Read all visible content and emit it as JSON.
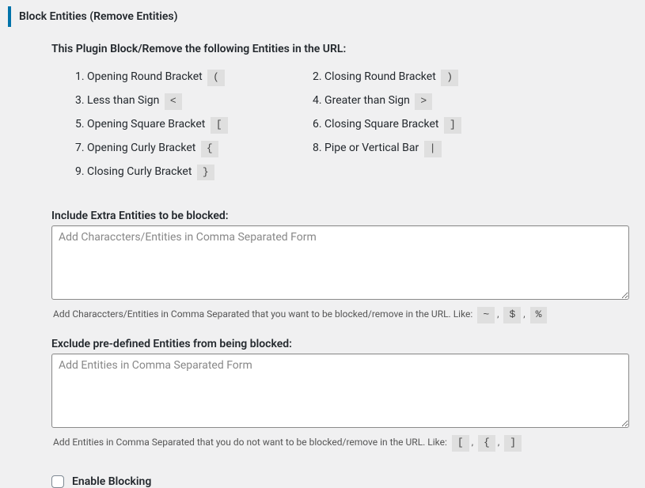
{
  "heading": "Block Entities (Remove Entities)",
  "intro": "This Plugin Block/Remove the following Entities in the URL:",
  "entities": [
    {
      "num": "1.",
      "label": "Opening Round Bracket",
      "char": "("
    },
    {
      "num": "2.",
      "label": "Closing Round Bracket",
      "char": ")"
    },
    {
      "num": "3.",
      "label": "Less than Sign",
      "char": "<"
    },
    {
      "num": "4.",
      "label": "Greater than Sign",
      "char": ">"
    },
    {
      "num": "5.",
      "label": "Opening Square Bracket",
      "char": "["
    },
    {
      "num": "6.",
      "label": "Closing Square Bracket",
      "char": "]"
    },
    {
      "num": "7.",
      "label": "Opening Curly Bracket",
      "char": "{"
    },
    {
      "num": "8.",
      "label": "Pipe or Vertical Bar",
      "char": "|"
    },
    {
      "num": "9.",
      "label": "Closing Curly Bracket",
      "char": "}"
    }
  ],
  "include": {
    "label": "Include Extra Entities to be blocked:",
    "placeholder": "Add Characcters/Entities in Comma Separated Form",
    "help_pre": "Add Characcters/Entities in Comma Separated that you want to be blocked/remove in the URL. Like:",
    "chips": [
      "~",
      "$",
      "%"
    ]
  },
  "exclude": {
    "label": "Exclude pre-defined Entities from being blocked:",
    "placeholder": "Add Entities in Comma Separated Form",
    "help_pre": "Add Entities in Comma Separated that you do not want to be blocked/remove in the URL. Like:",
    "chips": [
      "[",
      "{",
      "]"
    ]
  },
  "enable": {
    "label": "Enable Blocking"
  },
  "sep": ","
}
